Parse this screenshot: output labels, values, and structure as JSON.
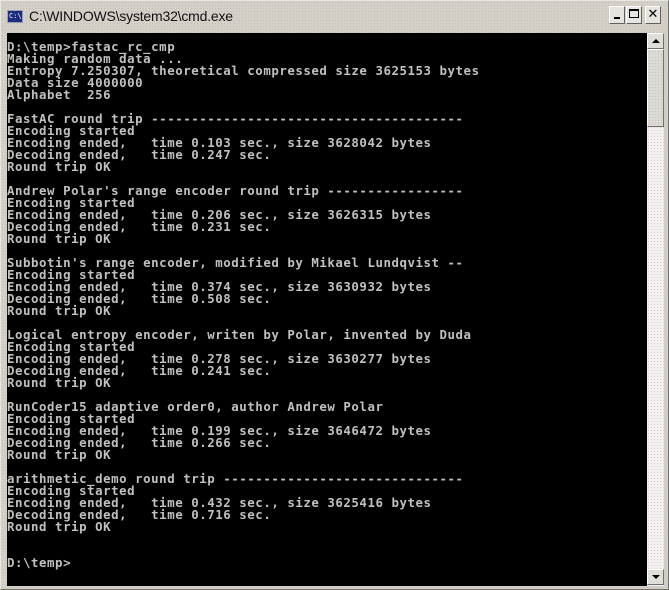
{
  "window": {
    "title": "C:\\WINDOWS\\system32\\cmd.exe",
    "icon": "cmd-app-icon",
    "icon_text": "C:\\",
    "controls": {
      "minimize": "minimize-icon",
      "maximize": "maximize-icon",
      "close": "close-icon",
      "close_glyph": "✕"
    }
  },
  "console": {
    "lines": [
      "D:\\temp>fastac_rc_cmp",
      "Making random data ...",
      "Entropy 7.250307, theoretical compressed size 3625153 bytes",
      "Data size 4000000",
      "Alphabet  256",
      "",
      "FastAC round trip ---------------------------------------",
      "Encoding started",
      "Encoding ended,   time 0.103 sec., size 3628042 bytes",
      "Decoding ended,   time 0.247 sec.",
      "Round trip OK",
      "",
      "Andrew Polar's range encoder round trip -----------------",
      "Encoding started",
      "Encoding ended,   time 0.206 sec., size 3626315 bytes",
      "Decoding ended,   time 0.231 sec.",
      "Round trip OK",
      "",
      "Subbotin's range encoder, modified by Mikael Lundqvist --",
      "Encoding started",
      "Encoding ended,   time 0.374 sec., size 3630932 bytes",
      "Decoding ended,   time 0.508 sec.",
      "Round trip OK",
      "",
      "Logical entropy encoder, writen by Polar, invented by Duda",
      "Encoding started",
      "Encoding ended,   time 0.278 sec., size 3630277 bytes",
      "Decoding ended,   time 0.241 sec.",
      "Round trip OK",
      "",
      "RunCoder15 adaptive order0, author Andrew Polar",
      "Encoding started",
      "Encoding ended,   time 0.199 sec., size 3646472 bytes",
      "Decoding ended,   time 0.266 sec.",
      "Round trip OK",
      "",
      "arithmetic_demo round trip ------------------------------",
      "Encoding started",
      "Encoding ended,   time 0.432 sec., size 3625416 bytes",
      "Decoding ended,   time 0.716 sec.",
      "Round trip OK",
      "",
      "",
      "D:\\temp>"
    ]
  },
  "scrollbar": {
    "position_fraction": 0,
    "visible_fraction": 0.15
  }
}
